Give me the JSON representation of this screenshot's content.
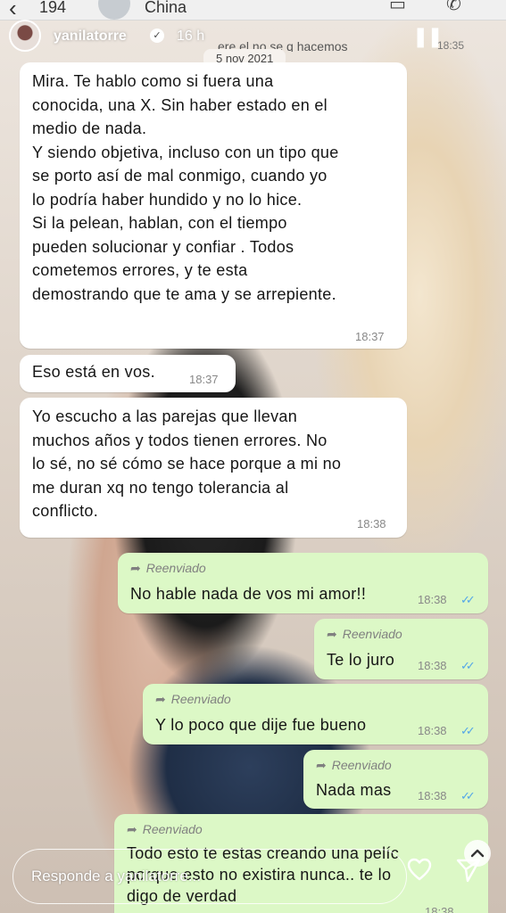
{
  "whatsapp_bar": {
    "count": "194",
    "contact": "China",
    "icons": [
      "back-arrow-icon",
      "avatar",
      "video-call-icon",
      "phone-icon"
    ]
  },
  "story": {
    "username": "yanilatorre",
    "time": "16 h",
    "cut_text": "ere el no se q hacemos",
    "cut_time": "18:35"
  },
  "date": "5 nov 2021",
  "messages": [
    {
      "dir": "in",
      "text": [
        "Mira. Te hablo como si fuera una",
        "conocida, una X. Sin haber estado en el",
        "medio de nada.",
        "Y siendo objetiva, incluso con un tipo que",
        "se porto así de mal conmigo, cuando yo",
        "lo podría haber hundido y no lo hice.",
        "Si la pelean, hablan, con el tiempo",
        "pueden solucionar y confiar . Todos",
        "cometemos errores, y te esta",
        "demostrando que te ama y se arrepiente."
      ],
      "time": "18:37"
    },
    {
      "dir": "in",
      "text": [
        "Eso está en vos."
      ],
      "time": "18:37"
    },
    {
      "dir": "in",
      "text": [
        "Yo escucho a las parejas que llevan",
        "muchos años y todos tienen errores. No",
        "lo sé, no sé cómo se hace porque a mi no",
        "me duran xq no tengo tolerancia al",
        "conflicto."
      ],
      "time": "18:38"
    },
    {
      "dir": "out",
      "forwarded": "Reenviado",
      "text": [
        "No hable nada de vos mi amor!!"
      ],
      "time": "18:38"
    },
    {
      "dir": "out",
      "forwarded": "Reenviado",
      "text": [
        "Te lo juro"
      ],
      "time": "18:38"
    },
    {
      "dir": "out",
      "forwarded": "Reenviado",
      "text": [
        "Y lo poco que dije fue bueno"
      ],
      "time": "18:38"
    },
    {
      "dir": "out",
      "forwarded": "Reenviado",
      "text": [
        "Nada mas"
      ],
      "time": "18:38"
    },
    {
      "dir": "out",
      "forwarded": "Reenviado",
      "text": [
        "Todo esto te estas creando una pelíc",
        "porque esto no existira nunca.. te lo",
        "digo de verdad"
      ],
      "time": "18:38"
    }
  ],
  "reply": {
    "placeholder": "Responde a yanilatorre..."
  },
  "colors": {
    "incoming_bubble": "#ffffff",
    "outgoing_bubble": "#dcf8c6",
    "read_checks": "#53a6e8"
  },
  "icons": [
    "heart-icon",
    "send-icon",
    "chevron-up-icon",
    "pause-icon",
    "verified-badge-icon",
    "forward-icon"
  ]
}
